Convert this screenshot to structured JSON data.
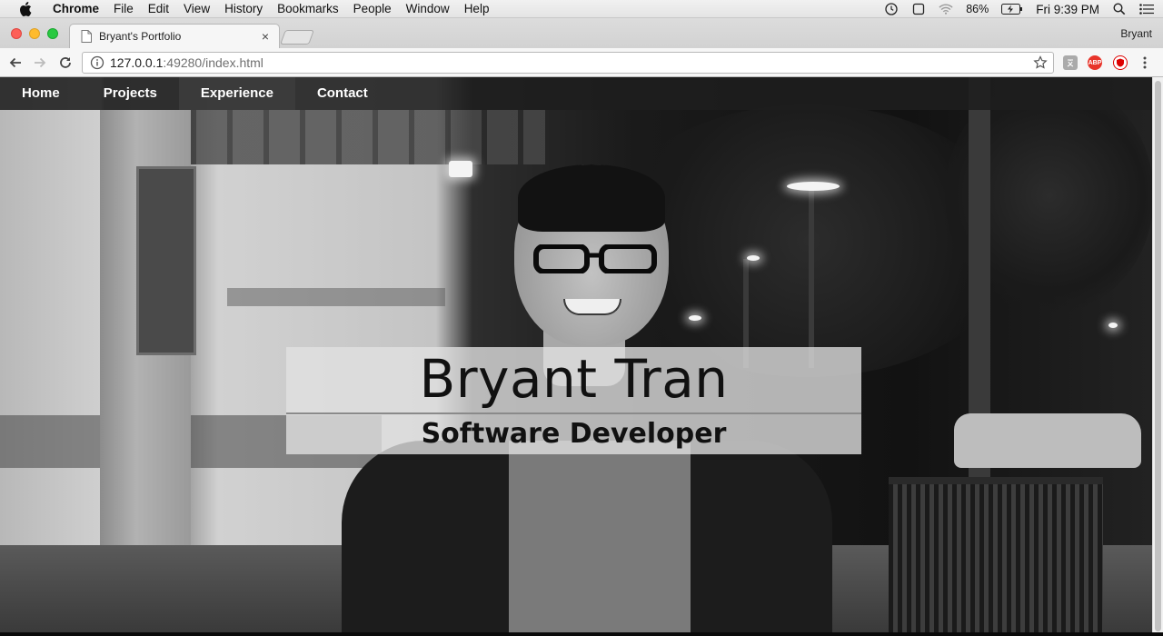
{
  "menubar": {
    "app_name": "Chrome",
    "items": [
      "File",
      "Edit",
      "View",
      "History",
      "Bookmarks",
      "People",
      "Window",
      "Help"
    ],
    "battery": "86%",
    "clock": "Fri 9:39 PM"
  },
  "browser": {
    "tab_title": "Bryant's Portfolio",
    "tab_close": "×",
    "profile_name": "Bryant",
    "url_host": "127.0.0.1",
    "url_rest": ":49280/index.html",
    "extensions": [
      "ABP"
    ]
  },
  "site": {
    "nav": [
      {
        "label": "Home"
      },
      {
        "label": "Projects"
      },
      {
        "label": "Experience"
      },
      {
        "label": "Contact"
      }
    ],
    "active_nav": "Experience",
    "name": "Bryant Tran",
    "role": "Software Developer"
  }
}
